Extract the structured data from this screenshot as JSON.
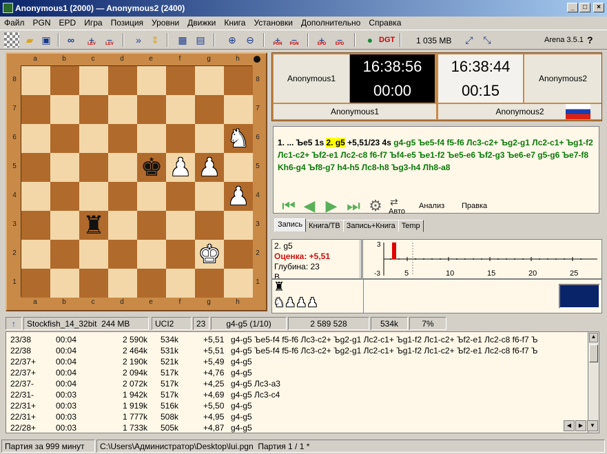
{
  "window": {
    "title": "Anonymous1 (2000) — Anonymous2 (2400)"
  },
  "menu": [
    "Файл",
    "PGN",
    "EPD",
    "Игра",
    "Позиция",
    "Уровни",
    "Движки",
    "Книга",
    "Установки",
    "Дополнительно",
    "Справка"
  ],
  "toolbar": {
    "memory": "1 035 MB",
    "version": "Arena 3.5.1",
    "help": "?"
  },
  "board": {
    "files": [
      "a",
      "b",
      "c",
      "d",
      "e",
      "f",
      "g",
      "h"
    ],
    "ranks": [
      "8",
      "7",
      "6",
      "5",
      "4",
      "3",
      "2",
      "1"
    ],
    "pieces": [
      {
        "sq": "h6",
        "glyph": "♞",
        "color": "white"
      },
      {
        "sq": "e5",
        "glyph": "♚",
        "color": "black"
      },
      {
        "sq": "f5",
        "glyph": "♟",
        "color": "white"
      },
      {
        "sq": "g5",
        "glyph": "♟",
        "color": "white"
      },
      {
        "sq": "h4",
        "glyph": "♟",
        "color": "white"
      },
      {
        "sq": "c3",
        "glyph": "♜",
        "color": "black"
      },
      {
        "sq": "g2",
        "glyph": "♚",
        "color": "white"
      }
    ]
  },
  "clocks": {
    "left": {
      "name": "Anonymous1",
      "time": "16:38:56",
      "move_time": "00:00",
      "label": "Anonymous1"
    },
    "right": {
      "name": "Anonymous2",
      "time": "16:38:44",
      "move_time": "00:15",
      "label": "Anonymous2"
    }
  },
  "notation": {
    "pre": "1. ... Ъe5 1s ",
    "current": "2. g5",
    "eval": " +5,51/23 4s ",
    "pv": "g4-g5 Ъe5-f4 f5-f6 Лс3-c2+ Ъg2-g1 Лс2-c1+ Ъg1-f2 Лс1-c2+ Ъf2-e1 Лс2-c8 f6-f7 Ъf4-e5 Ъe1-f2 Ъe5-e6 Ъf2-g3 Ъe6-e7 g5-g6 Ъe7-f8 Kh6-g4 Ъf8-g7 h4-h5 Лс8-h8 Ъg3-h4 Лh8-a8"
  },
  "nav": {
    "auto": "Авто",
    "analysis": "Анализ",
    "rules": "Правка"
  },
  "tabs": [
    "Запись",
    "Книга/ТВ",
    "Запись+Книга",
    "Temp"
  ],
  "eval_panel": {
    "move": "2. g5",
    "score": "Оценка: +5,51",
    "depth": "Глубина: 23",
    "extra": "В..."
  },
  "graph": {
    "y_top": "3",
    "y_bottom": "-3",
    "x_labels": [
      "5",
      "10",
      "15",
      "20",
      "25"
    ],
    "bar_value": 3
  },
  "material": {
    "black": [
      "♜"
    ],
    "white": [
      "♞",
      "♟",
      "♟",
      "♟"
    ]
  },
  "engine_status": {
    "arrow": "↑",
    "name": "Stockfish_14_32bit",
    "mem": "244 MB",
    "proto": "UCI2",
    "depth": "23",
    "move": "g4-g5 (1/10)",
    "nodes": "2 589 528",
    "nps": "534k",
    "load": "7%"
  },
  "analysis_rows": [
    {
      "depth": "23/38",
      "time": "00:04",
      "nodes": "2 590k",
      "nps": "534k",
      "score": "+5,51",
      "pv": "g4-g5  Ъe5-f4  f5-f6  Лс3-c2+  Ъg2-g1  Лс2-c1+  Ъg1-f2  Лс1-c2+  Ъf2-e1  Лс2-c8  f6-f7  Ъ"
    },
    {
      "depth": "22/38",
      "time": "00:04",
      "nodes": "2 464k",
      "nps": "531k",
      "score": "+5,51",
      "pv": "g4-g5  Ъe5-f4  f5-f6  Лс3-c2+  Ъg2-g1  Лс2-c1+  Ъg1-f2  Лс1-c2+  Ъf2-e1  Лс2-c8  f6-f7  Ъ"
    },
    {
      "depth": "22/37+",
      "time": "00:04",
      "nodes": "2 190k",
      "nps": "521k",
      "score": "+5,49",
      "pv": "g4-g5"
    },
    {
      "depth": "22/37+",
      "time": "00:04",
      "nodes": "2 094k",
      "nps": "517k",
      "score": "+4,76",
      "pv": "g4-g5"
    },
    {
      "depth": "22/37-",
      "time": "00:04",
      "nodes": "2 072k",
      "nps": "517k",
      "score": "+4,25",
      "pv": "g4-g5  Лс3-a3"
    },
    {
      "depth": "22/31-",
      "time": "00:03",
      "nodes": "1 942k",
      "nps": "517k",
      "score": "+4,69",
      "pv": "g4-g5  Лс3-c4"
    },
    {
      "depth": "22/31+",
      "time": "00:03",
      "nodes": "1 919k",
      "nps": "516k",
      "score": "+5,50",
      "pv": "g4-g5"
    },
    {
      "depth": "22/31+",
      "time": "00:03",
      "nodes": "1 777k",
      "nps": "508k",
      "score": "+4,95",
      "pv": "g4-g5"
    },
    {
      "depth": "22/28+",
      "time": "00:03",
      "nodes": "1 733k",
      "nps": "505k",
      "score": "+4,87",
      "pv": "g4-g5"
    }
  ],
  "statusbar": {
    "time_control": "Партия за 999 минут",
    "path": "C:\\Users\\Администратор\\Desktop\\lui.pgn",
    "game": "Партия 1 / 1 *"
  }
}
